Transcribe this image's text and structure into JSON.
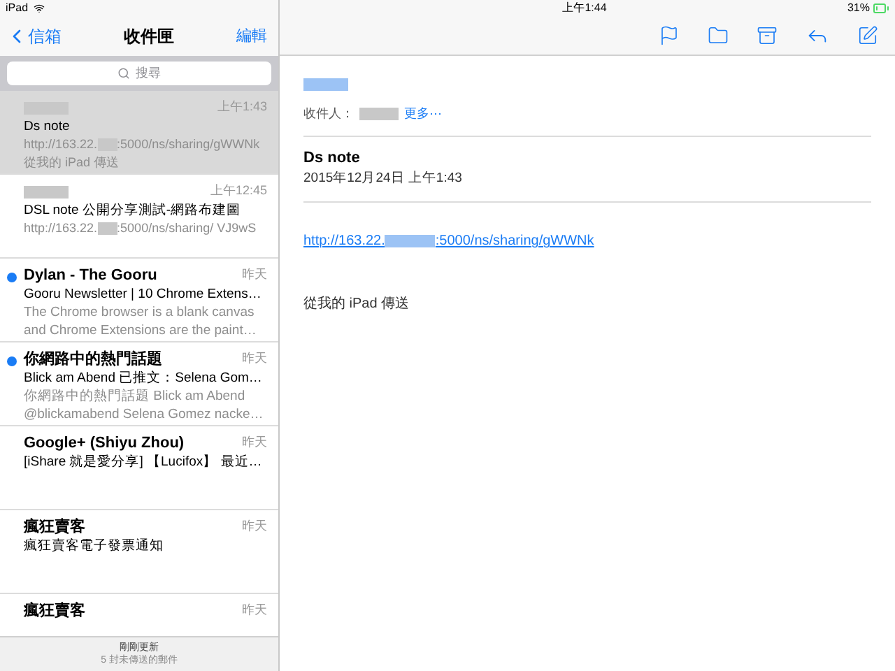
{
  "status_bar": {
    "device": "iPad",
    "time": "上午1:44",
    "battery": "31%"
  },
  "mailbox": {
    "back": "信箱",
    "title": "收件匣",
    "edit": "編輯",
    "search": {
      "placeholder": "搜尋"
    },
    "messages": [
      {
        "kind": "blurred",
        "time": "上午1:43",
        "subject": "Ds note",
        "preview_start": "http://163.22.",
        "preview_end": ":5000/ns/sharing/gWWNk 從我的 iPad 傳送",
        "unread": false,
        "selected": true
      },
      {
        "kind": "blurred",
        "time": "上午12:45",
        "subject": "DSL note 公開分享測試-網路布建圖",
        "preview_start": "http://163.22.",
        "preview_end": ":5000/ns/sharing/ VJ9wS",
        "unread": false,
        "selected": false
      },
      {
        "kind": "plain",
        "sender": "Dylan - The Gooru",
        "time": "昨天",
        "subject": "Gooru Newsletter | 10 Chrome Extens…",
        "preview": "The Chrome browser is a blank canvas and Chrome Extensions are the paint…",
        "unread": true,
        "selected": false
      },
      {
        "kind": "plain",
        "sender": "你網路中的熱門話題",
        "time": "昨天",
        "subject": "Blick am Abend 已推文：Selena Gom…",
        "preview": "你網路中的熱門話題 Blick am Abend @blickamabend Selena Gomez nacke…",
        "unread": true,
        "selected": false
      },
      {
        "kind": "plain",
        "sender": "Google+ (Shiyu Zhou)",
        "time": "昨天",
        "subject": "[iShare 就是愛分享] 【Lucifox】 最近…",
        "unread": false,
        "selected": false
      },
      {
        "kind": "plain",
        "sender": "瘋狂賣客",
        "time": "昨天",
        "subject": "瘋狂賣客電子發票通知",
        "unread": false,
        "selected": false
      },
      {
        "kind": "plain",
        "sender": "瘋狂賣客",
        "time": "昨天",
        "unread": false,
        "selected": false
      }
    ],
    "footer": {
      "status": "剛剛更新",
      "unsent": "5 封未傳送的郵件"
    }
  },
  "message": {
    "to_label": "收件人：",
    "more": "更多⋯",
    "subject": "Ds note",
    "date": "2015年12月24日 上午1:43",
    "link_start": "http://163.22.",
    "link_end": ":5000/ns/sharing/gWWNk",
    "body": "從我的 iPad 傳送"
  }
}
